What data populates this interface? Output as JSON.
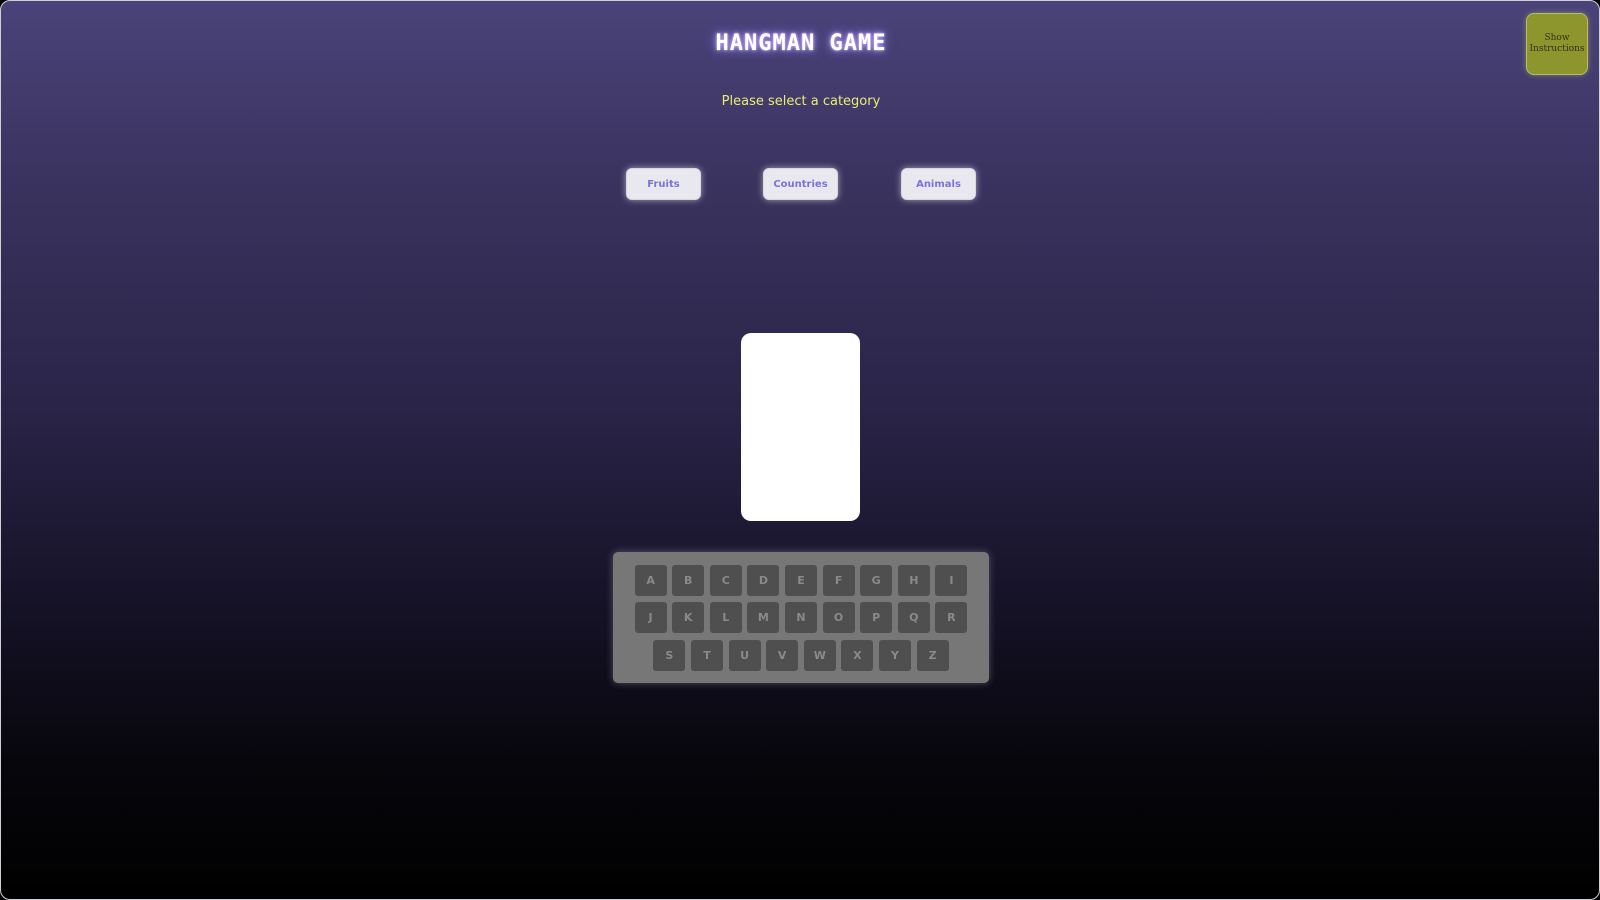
{
  "header": {
    "title": "HANGMAN GAME",
    "subtitle": "Please select a category"
  },
  "instructions_button": {
    "label": "Show Instructions"
  },
  "categories": [
    {
      "label": "Fruits"
    },
    {
      "label": "Countries"
    },
    {
      "label": "Animals"
    }
  ],
  "keyboard": {
    "rows": [
      [
        "A",
        "B",
        "C",
        "D",
        "E",
        "F",
        "G",
        "H",
        "I"
      ],
      [
        "J",
        "K",
        "L",
        "M",
        "N",
        "O",
        "P",
        "Q",
        "R"
      ],
      [
        "S",
        "T",
        "U",
        "V",
        "W",
        "X",
        "Y",
        "Z"
      ]
    ]
  },
  "colors": {
    "accent_yellow": "#e7ee74",
    "instructions_bg": "#8d962c",
    "category_text": "#7b74d8",
    "key_bg": "#4f4f4f",
    "keyboard_bg": "#777777"
  }
}
